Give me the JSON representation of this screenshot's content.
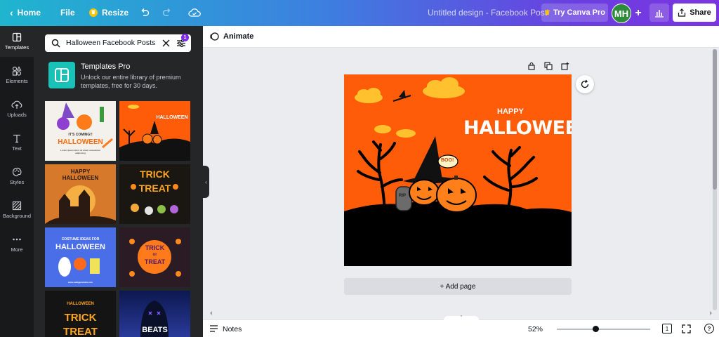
{
  "topbar": {
    "home_label": "Home",
    "file_label": "File",
    "resize_label": "Resize",
    "design_title": "Untitled design - Facebook Post",
    "try_pro_label": "Try Canva Pro",
    "avatar_initials": "MH",
    "plus_label": "+",
    "share_label": "Share"
  },
  "rail": {
    "items": [
      {
        "label": "Templates",
        "icon": "templates-icon"
      },
      {
        "label": "Elements",
        "icon": "elements-icon"
      },
      {
        "label": "Uploads",
        "icon": "uploads-icon"
      },
      {
        "label": "Text",
        "icon": "text-icon"
      },
      {
        "label": "Styles",
        "icon": "styles-icon"
      },
      {
        "label": "Background",
        "icon": "background-icon"
      },
      {
        "label": "More",
        "icon": "more-icon"
      }
    ]
  },
  "panel": {
    "search_value": "Halloween Facebook Posts",
    "filter_badge": "1",
    "promo_title": "Templates Pro",
    "promo_desc": "Unlock our entire library of premium templates, free for 30 days.",
    "thumbs": [
      {
        "line1": "IT'S COMING!!",
        "line2": "HALLOWEEN",
        "line3": "Lorem ipsum dolor sit amet consectetur adipiscing"
      },
      {
        "line1": "HALLOWEEN",
        "line2": "",
        "line3": ""
      },
      {
        "line1": "HAPPY",
        "line2": "HALLOWEEN",
        "line3": ""
      },
      {
        "line1": "TRICK",
        "line2": "TREAT",
        "line3": ""
      },
      {
        "line1": "COSTUME IDEAS FOR",
        "line2": "HALLOWEEN",
        "line3": "www.reallygreatsite.com"
      },
      {
        "line1": "TRICK",
        "line2": "or",
        "line3": "TREAT"
      },
      {
        "line1": "HALLOWEEN",
        "line2": "TRICK",
        "line3": "TREAT"
      },
      {
        "line1": "BEATS",
        "line2": "",
        "line3": ""
      }
    ]
  },
  "editor": {
    "animate_label": "Animate",
    "design_text_small": "HAPPY",
    "design_text_big": "HALLOWEEN",
    "boo_text": "BOO!",
    "rip_text": "RIP",
    "add_page_label": "+ Add page",
    "notes_label": "Notes",
    "zoom_label": "52%",
    "zoom_value": 0.42,
    "page_count": "1",
    "help_label": "?"
  },
  "colors": {
    "accent": "#7d2ae8",
    "design_bg": "#ff5c0a"
  }
}
